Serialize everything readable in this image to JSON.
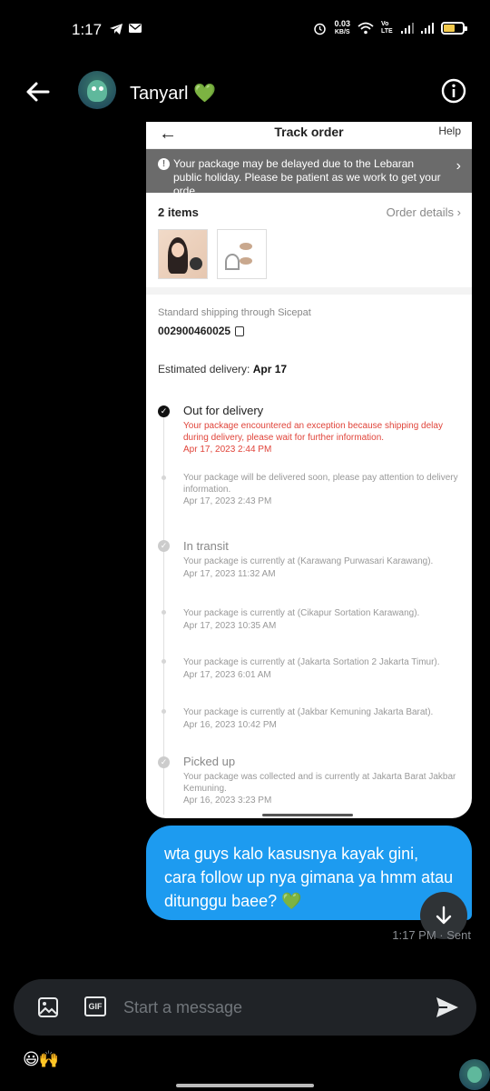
{
  "status_bar": {
    "time": "1:17",
    "speed_value": "0.03",
    "speed_unit": "KB/S",
    "network": "Vo LTE",
    "battery_color": "#f2c94c"
  },
  "header": {
    "name": "Tanyarl",
    "name_emoji": "💚"
  },
  "shared_image": {
    "title": "Track order",
    "help": "Help",
    "banner": "Your package may be delayed due to the Lebaran public holiday. Please be patient as we work to get your orde ...",
    "items_count": "2 items",
    "order_details": "Order details",
    "shipping_label": "Standard shipping through Sicepat",
    "tracking_number": "002900460025",
    "estimated_label": "Estimated delivery:",
    "estimated_date": "Apr 17",
    "events": [
      {
        "title": "Out for delivery",
        "desc": "Your package encountered an exception because shipping delay during delivery, please wait for further information.",
        "time": "Apr 17, 2023 2:44 PM"
      },
      {
        "title": "",
        "desc": "Your package will be delivered soon, please pay attention to delivery information.",
        "time": "Apr 17, 2023 2:43 PM"
      },
      {
        "title": "In transit",
        "desc": "Your package is currently at (Karawang Purwasari Karawang).",
        "time": "Apr 17, 2023 11:32 AM"
      },
      {
        "title": "",
        "desc": "Your package is currently at (Cikapur Sortation Karawang).",
        "time": "Apr 17, 2023 10:35 AM"
      },
      {
        "title": "",
        "desc": "Your package is currently at (Jakarta Sortation 2 Jakarta Timur).",
        "time": "Apr 17, 2023 6:01 AM"
      },
      {
        "title": "",
        "desc": "Your package is currently at (Jakbar Kemuning Jakarta Barat).",
        "time": "Apr 16, 2023 10:42 PM"
      },
      {
        "title": "Picked up",
        "desc": "Your package was collected and is currently at Jakarta Barat Jakbar Kemuning.",
        "time": "Apr 16, 2023 3:23 PM"
      }
    ]
  },
  "message": {
    "text": "wta guys kalo kasusnya kayak gini, cara follow up nya gimana ya hmm atau ditunggu baee? 💚",
    "time": "1:17 PM",
    "status": "Sent",
    "bubble_color": "#1d9bf0"
  },
  "composer": {
    "gif_label": "GIF",
    "placeholder": "Start a message"
  },
  "reactions": "😃🙌"
}
